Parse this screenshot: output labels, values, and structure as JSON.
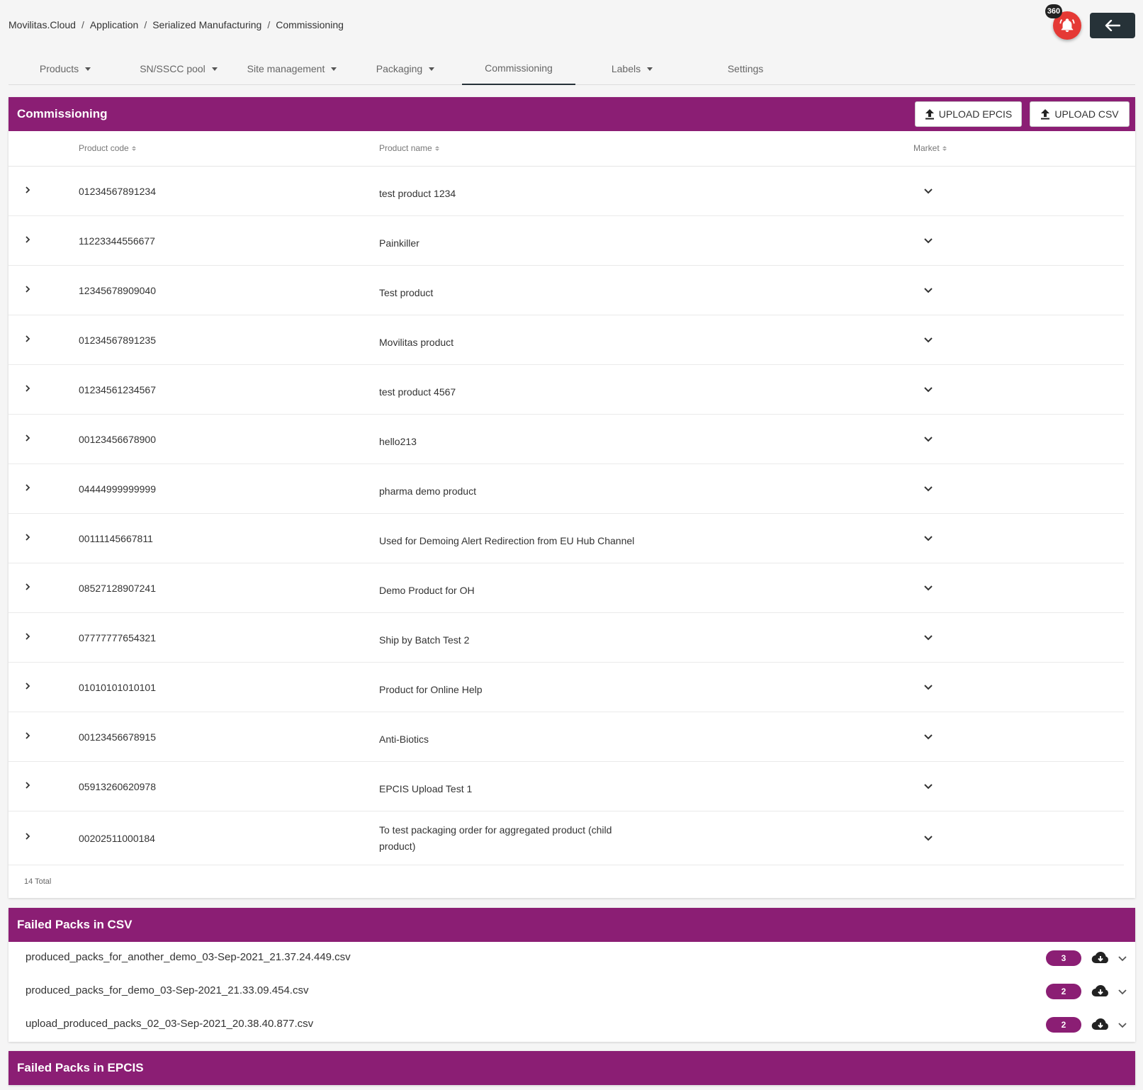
{
  "breadcrumb": [
    "Movilitas.Cloud",
    "Application",
    "Serialized Manufacturing",
    "Commissioning"
  ],
  "notifications": {
    "badge": "360"
  },
  "tabs": [
    {
      "label": "Products",
      "dropdown": true,
      "active": false
    },
    {
      "label": "SN/SSCC pool",
      "dropdown": true,
      "active": false
    },
    {
      "label": "Site management",
      "dropdown": true,
      "active": false
    },
    {
      "label": "Packaging",
      "dropdown": true,
      "active": false
    },
    {
      "label": "Commissioning",
      "dropdown": false,
      "active": true
    },
    {
      "label": "Labels",
      "dropdown": true,
      "active": false
    },
    {
      "label": "Settings",
      "dropdown": false,
      "active": false
    }
  ],
  "commissioning": {
    "title": "Commissioning",
    "upload_epcis": "UPLOAD EPCIS",
    "upload_csv": "UPLOAD CSV",
    "columns": {
      "code": "Product code",
      "name": "Product name",
      "market": "Market"
    },
    "rows": [
      {
        "code": "01234567891234",
        "name": "test product 1234"
      },
      {
        "code": "11223344556677",
        "name": "Painkiller"
      },
      {
        "code": "12345678909040",
        "name": "Test product"
      },
      {
        "code": "01234567891235",
        "name": "Movilitas product"
      },
      {
        "code": "01234561234567",
        "name": "test product 4567"
      },
      {
        "code": "00123456678900",
        "name": "hello213"
      },
      {
        "code": "04444999999999",
        "name": "pharma demo product"
      },
      {
        "code": "00111145667811",
        "name": "Used for Demoing Alert Redirection from EU Hub Channel"
      },
      {
        "code": "08527128907241",
        "name": "Demo Product for OH"
      },
      {
        "code": "07777777654321",
        "name": "Ship by Batch Test 2"
      },
      {
        "code": "01010101010101",
        "name": "Product for Online Help"
      },
      {
        "code": "00123456678915",
        "name": "Anti-Biotics"
      },
      {
        "code": "05913260620978",
        "name": "EPCIS Upload Test 1"
      },
      {
        "code": "00202511000184",
        "name": "To test packaging order for aggregated product (child product)"
      }
    ],
    "total": "14 Total"
  },
  "failed_csv": {
    "title": "Failed Packs in CSV",
    "files": [
      {
        "name": "produced_packs_for_another_demo_03-Sep-2021_21.37.24.449.csv",
        "count": "3"
      },
      {
        "name": "produced_packs_for_demo_03-Sep-2021_21.33.09.454.csv",
        "count": "2"
      },
      {
        "name": "upload_produced_packs_02_03-Sep-2021_20.38.40.877.csv",
        "count": "2"
      }
    ]
  },
  "failed_epcis": {
    "title": "Failed Packs in EPCIS"
  },
  "colors": {
    "header": "#8b1e74",
    "bell": "#e53935",
    "back": "#263238"
  }
}
